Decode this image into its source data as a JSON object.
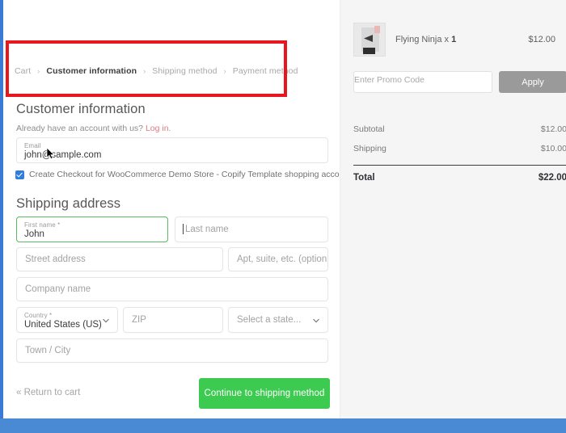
{
  "breadcrumb": {
    "items": [
      {
        "label": "Cart",
        "active": false
      },
      {
        "label": "Customer information",
        "active": true
      },
      {
        "label": "Shipping method",
        "active": false
      },
      {
        "label": "Payment method",
        "active": false
      }
    ],
    "separator": "›"
  },
  "customer": {
    "heading": "Customer information",
    "login_prompt": "Already have an account with us?",
    "login_link": "Log in.",
    "email": {
      "label": "Email",
      "value": "john@sample.com"
    },
    "create_account_label": "Create Checkout for WooCommerce Demo Store - Copify Template shopping account.",
    "create_account_checked": true
  },
  "shipping_address": {
    "heading": "Shipping address",
    "first_name": {
      "label": "First name *",
      "value": "John"
    },
    "last_name": {
      "placeholder": "Last name",
      "value": ""
    },
    "street": {
      "placeholder": "Street address",
      "value": ""
    },
    "apartment": {
      "placeholder": "Apt, suite, etc. (option",
      "value": ""
    },
    "company": {
      "placeholder": "Company name",
      "value": ""
    },
    "country": {
      "label": "Country *",
      "value": "United States (US)"
    },
    "zip": {
      "placeholder": "ZIP",
      "value": ""
    },
    "state": {
      "placeholder": "Select a state...",
      "value": ""
    },
    "city": {
      "placeholder": "Town / City",
      "value": ""
    }
  },
  "actions": {
    "return_to_cart": "« Return to cart",
    "continue_button": "Continue to shipping method"
  },
  "order_summary": {
    "item": {
      "name_prefix": "Flying Ninja x",
      "quantity": "1",
      "price": "$12.00"
    },
    "promo": {
      "placeholder": "Enter Promo Code",
      "apply_label": "Apply"
    },
    "rows": [
      {
        "label": "Subtotal",
        "value": "$12.00"
      },
      {
        "label": "Shipping",
        "value": "$10.00"
      }
    ],
    "total": {
      "label": "Total",
      "value": "$22.00"
    }
  },
  "colors": {
    "accent_green": "#3ccb50",
    "annotation_red": "#e8161d",
    "link_red": "#e07a82",
    "checkbox_blue": "#2f7de1",
    "apply_gray": "#9a9a9a",
    "valid_border_green": "#5bba5f"
  }
}
